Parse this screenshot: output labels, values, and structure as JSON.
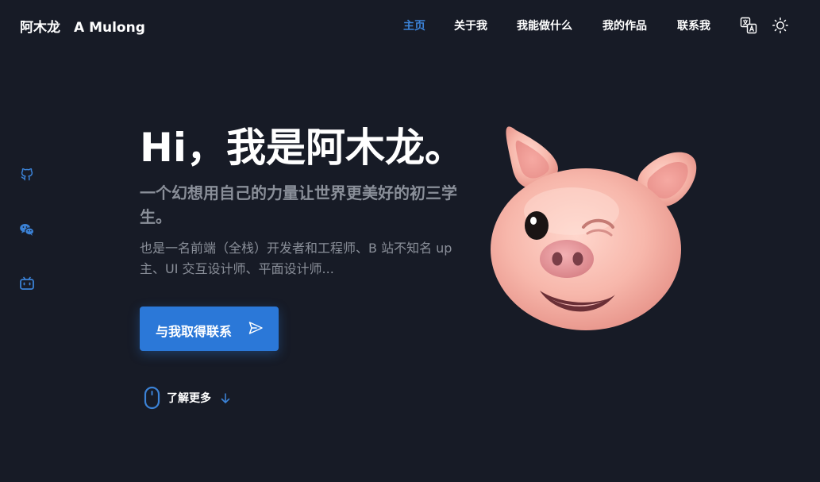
{
  "header": {
    "brand": "阿木龙　A Mulong",
    "nav": [
      {
        "label": "主页",
        "active": true
      },
      {
        "label": "关于我",
        "active": false
      },
      {
        "label": "我能做什么",
        "active": false
      },
      {
        "label": "我的作品",
        "active": false
      },
      {
        "label": "联系我",
        "active": false
      }
    ],
    "icons": [
      "translate-icon",
      "theme-sun-icon"
    ]
  },
  "social": [
    "github-icon",
    "wechat-icon",
    "bilibili-icon"
  ],
  "hero": {
    "title": "Hi，我是阿木龙。",
    "subtitle": "一个幻想用自己的力量让世界更美好的初三学生。",
    "description": "也是一名前端（全栈）开发者和工程师、B 站不知名 up 主、UI 交互设计师、平面设计师...",
    "cta_label": "与我取得联系",
    "more_label": "了解更多"
  },
  "colors": {
    "background": "#171b26",
    "accent": "#2b78d8",
    "active_nav": "#3b82d6",
    "muted_text": "#8a8f99"
  }
}
